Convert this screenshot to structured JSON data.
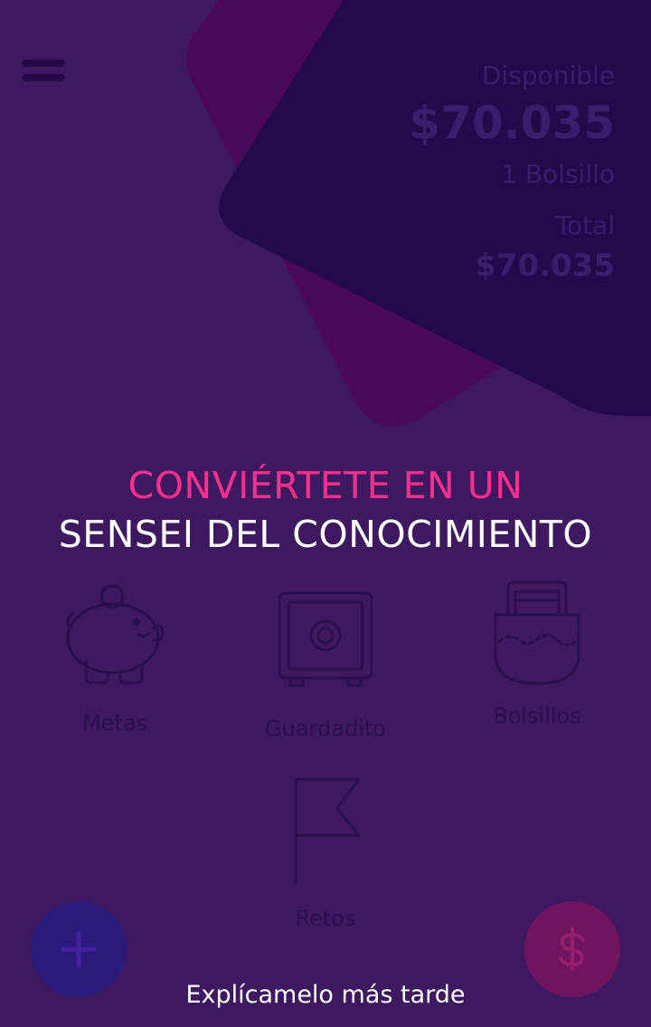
{
  "balance": {
    "available_label": "Disponible",
    "available_amount": "$70.035",
    "pockets_count": "1 Bolsillo",
    "total_label": "Total",
    "total_amount": "$70.035"
  },
  "headline": {
    "line1": "CONVIÉRTETE EN UN",
    "line2": "SENSEI DEL CONOCIMIENTO"
  },
  "features": {
    "goals": {
      "label": "Metas",
      "icon": "piggy-bank-icon"
    },
    "savings": {
      "label": "Guardadito",
      "icon": "safe-icon"
    },
    "pockets": {
      "label": "Bolsillos",
      "icon": "pocket-icon"
    },
    "challenges": {
      "label": "Retos",
      "icon": "flag-icon"
    }
  },
  "actions": {
    "add_icon": "plus-icon",
    "money_icon": "dollar-icon",
    "explain_later": "Explícamelo más tarde"
  },
  "colors": {
    "background": "#3e1960",
    "accent_pink": "#ff2f8e",
    "card_dark": "#230a4b",
    "card_magenta": "#49085a"
  }
}
